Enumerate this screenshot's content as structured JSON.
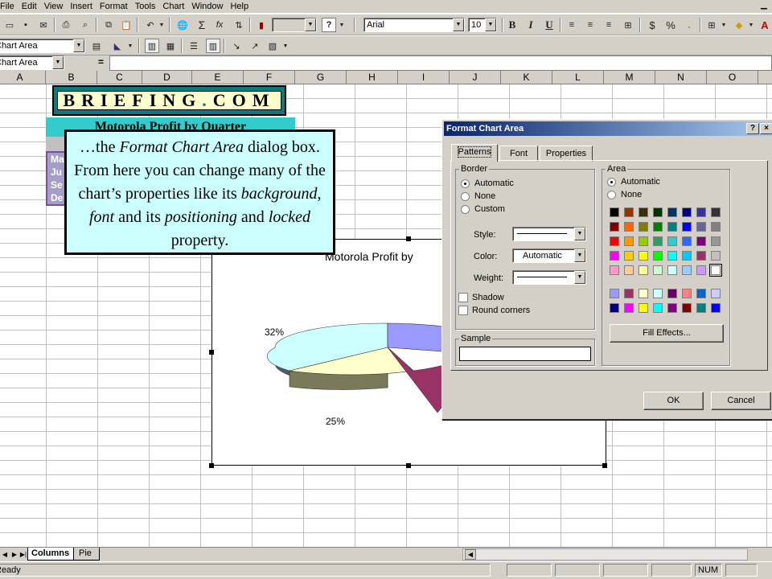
{
  "menu": [
    "File",
    "Edit",
    "View",
    "Insert",
    "Format",
    "Tools",
    "Chart",
    "Window",
    "Help"
  ],
  "toolbar": {
    "font_name": "Arial",
    "font_size": "10",
    "bold": "B",
    "italic": "I",
    "underline": "U",
    "currency": "$",
    "percent": "%",
    "chart_object_select": "Chart Area"
  },
  "formula_bar": {
    "name_box": "Chart Area",
    "equals": "="
  },
  "columns": [
    "A",
    "B",
    "C",
    "D",
    "E",
    "F",
    "G",
    "H",
    "I",
    "J",
    "K",
    "L",
    "M",
    "N",
    "O"
  ],
  "sheet": {
    "logo_text": "BRIEFING.COM",
    "logo_left": "BRIEFING",
    "logo_dot": ".",
    "logo_right": "COM",
    "header_text": "Motorola Profit by Quarter",
    "quarter_labels": [
      "Ma",
      "Ju",
      "Se",
      "De"
    ]
  },
  "chart": {
    "title": "Motorola Profit by",
    "label_left": "32%",
    "label_bottom": "25%"
  },
  "chart_data": {
    "type": "pie",
    "title": "Motorola Profit by",
    "slice_labels_visible": [
      "32%",
      "25%"
    ],
    "colors": [
      "#9999ff",
      "#993366",
      "#ffffcc",
      "#ccffff"
    ]
  },
  "callout": {
    "t1": "…the ",
    "t2": "Format Chart Area",
    "t3": " dialog box.  From here you can change many of the chart’s properties like its ",
    "t4": "background",
    "t5": ", ",
    "t6": "font",
    "t7": " and its ",
    "t8": "positioning",
    "t9": " and ",
    "t10": "locked",
    "t11": " property."
  },
  "dialog": {
    "title": "Format Chart Area",
    "help_button": "?",
    "close_button": "×",
    "tabs": [
      "Patterns",
      "Font",
      "Properties"
    ],
    "border": {
      "caption": "Border",
      "options": [
        "Automatic",
        "None",
        "Custom"
      ],
      "selected": "Automatic",
      "style_label": "Style:",
      "color_label": "Color:",
      "color_value": "Automatic",
      "weight_label": "Weight:",
      "shadow_label": "Shadow",
      "round_corners_label": "Round corners"
    },
    "area": {
      "caption": "Area",
      "options": [
        "Automatic",
        "None"
      ],
      "selected": "Automatic",
      "palette": [
        [
          "#000000",
          "#993300",
          "#333300",
          "#003300",
          "#003366",
          "#000080",
          "#333399",
          "#333333"
        ],
        [
          "#800000",
          "#ff6600",
          "#808000",
          "#008000",
          "#008080",
          "#0000ff",
          "#666699",
          "#808080"
        ],
        [
          "#ff0000",
          "#ff9900",
          "#99cc00",
          "#339966",
          "#33cccc",
          "#3366ff",
          "#800080",
          "#969696"
        ],
        [
          "#ff00ff",
          "#ffcc00",
          "#ffff00",
          "#00ff00",
          "#00ffff",
          "#00ccff",
          "#993366",
          "#c0c0c0"
        ],
        [
          "#ff99cc",
          "#ffcc99",
          "#ffff99",
          "#ccffcc",
          "#ccffff",
          "#99ccff",
          "#cc99ff",
          "#ffffff"
        ],
        [
          "#9999ff",
          "#993366",
          "#ffffcc",
          "#ccffff",
          "#660066",
          "#ff8080",
          "#0066cc",
          "#ccccff"
        ],
        [
          "#000080",
          "#ff00ff",
          "#ffff00",
          "#00ffff",
          "#800080",
          "#800000",
          "#008080",
          "#0000ff"
        ]
      ],
      "fill_effects_label": "Fill Effects..."
    },
    "sample_caption": "Sample",
    "ok_label": "OK",
    "cancel_label": "Cancel"
  },
  "sheet_tabs": [
    "Columns",
    "Pie"
  ],
  "status": {
    "left": "Ready",
    "num": "NUM"
  }
}
